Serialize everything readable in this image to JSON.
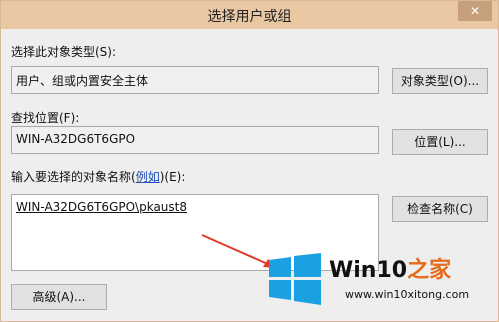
{
  "dialog": {
    "title": "选择用户或组",
    "close_glyph": "✕"
  },
  "object_type": {
    "label": "选择此对象类型(S):",
    "value": "用户、组或内置安全主体",
    "button": "对象类型(O)..."
  },
  "location": {
    "label": "查找位置(F):",
    "value": "WIN-A32DG6T6GPO",
    "button": "位置(L)..."
  },
  "object_names": {
    "label_prefix": "输入要选择的对象名称(",
    "label_link": "例如",
    "label_suffix": ")(E):",
    "value": "WIN-A32DG6T6GPO\\pkaust8",
    "check_button": "检查名称(C)"
  },
  "advanced_button": "高级(A)...",
  "watermark": {
    "brand": "Win10",
    "suffix": "之家",
    "url": "www.win10xitong.com",
    "logo_icon": "windows-logo-icon"
  },
  "colors": {
    "titlebar": "#e9c7a3",
    "arrow": "#e23b2b",
    "logo_blue": "#1ba1e2",
    "accent_orange": "#e56c1d"
  }
}
